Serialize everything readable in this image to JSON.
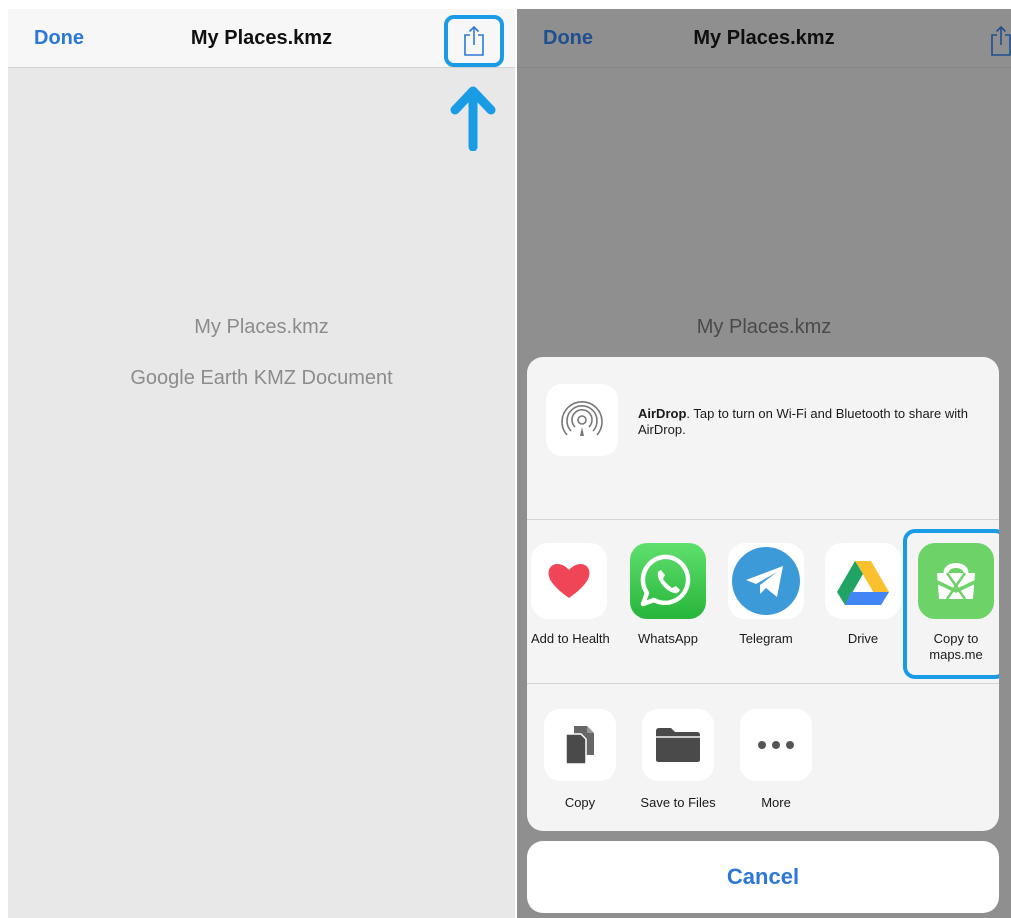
{
  "left_screen": {
    "done_label": "Done",
    "title": "My Places.kmz",
    "document_name": "My Places.kmz",
    "document_type": "Google Earth KMZ Document"
  },
  "right_screen": {
    "done_label": "Done",
    "title": "My Places.kmz",
    "document_name": "My Places.kmz",
    "share_sheet": {
      "airdrop_title": "AirDrop",
      "airdrop_message": ". Tap to turn on Wi-Fi and Bluetooth to share with AirDrop.",
      "apps": [
        {
          "label": "Add to Health",
          "icon": "heart-icon"
        },
        {
          "label": "WhatsApp",
          "icon": "whatsapp-icon"
        },
        {
          "label": "Telegram",
          "icon": "telegram-icon"
        },
        {
          "label": "Drive",
          "icon": "google-drive-icon"
        },
        {
          "label": "Copy to maps.me",
          "icon": "maps-me-icon"
        }
      ],
      "actions": [
        {
          "label": "Copy",
          "icon": "copy-icon"
        },
        {
          "label": "Save to Files",
          "icon": "folder-icon"
        },
        {
          "label": "More",
          "icon": "more-icon"
        }
      ],
      "cancel_label": "Cancel"
    }
  },
  "colors": {
    "accent": "#2d78d7",
    "highlight": "#1a9be6"
  }
}
